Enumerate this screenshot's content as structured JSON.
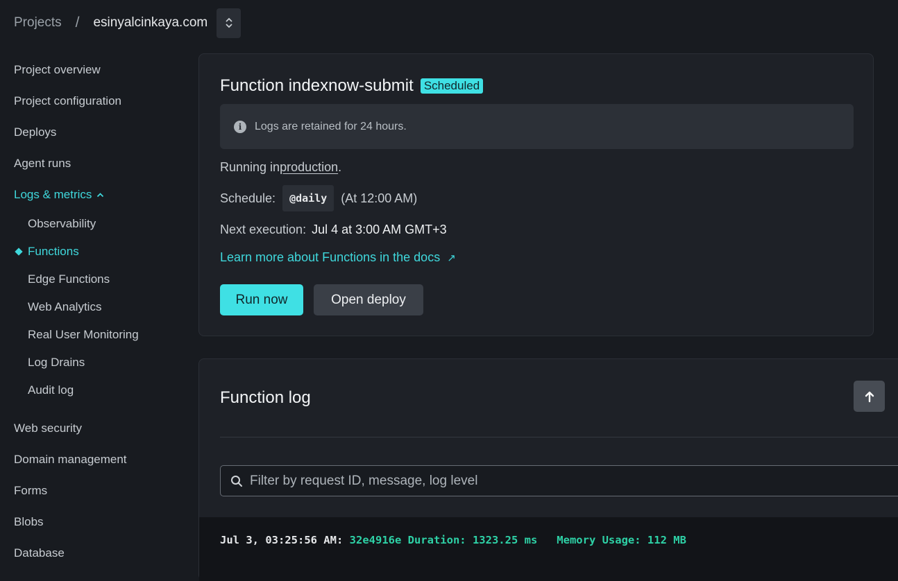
{
  "breadcrumb": {
    "projects": "Projects",
    "separator": "/",
    "site": "esinyalcinkaya.com"
  },
  "sidebar": {
    "items": [
      {
        "label": "Project overview"
      },
      {
        "label": "Project configuration"
      },
      {
        "label": "Deploys"
      },
      {
        "label": "Agent runs"
      },
      {
        "label": "Logs & metrics",
        "expanded": true
      }
    ],
    "subitems": [
      {
        "label": "Observability"
      },
      {
        "label": "Functions",
        "current": true
      },
      {
        "label": "Edge Functions"
      },
      {
        "label": "Web Analytics"
      },
      {
        "label": "Real User Monitoring"
      },
      {
        "label": "Log Drains"
      },
      {
        "label": "Audit log"
      }
    ],
    "items_after": [
      {
        "label": "Web security"
      },
      {
        "label": "Domain management"
      },
      {
        "label": "Forms"
      },
      {
        "label": "Blobs"
      },
      {
        "label": "Database"
      }
    ]
  },
  "function_card": {
    "title": "Function indexnow-submit",
    "badge": "Scheduled",
    "notice": "Logs are retained for 24 hours.",
    "running_prefix": "Running in ",
    "running_env": "production",
    "running_suffix": ".",
    "schedule_label": "Schedule:",
    "schedule_cron": "@daily",
    "schedule_human": "(At 12:00 AM)",
    "next_label": "Next execution:",
    "next_value": "Jul 4 at 3:00 AM GMT+3",
    "docs_link": "Learn more about Functions in the docs",
    "run_now": "Run now",
    "open_deploy": "Open deploy"
  },
  "function_log": {
    "title": "Function log",
    "filter_placeholder": "Filter by request ID, message, log level",
    "entries": [
      {
        "timestamp": "Jul 3, 03:25:56 AM:",
        "message": "32e4916e Duration: 1323.25 ms",
        "memory": "Memory Usage: 112 MB"
      }
    ]
  },
  "colors": {
    "accent": "#3fd8dc",
    "button_primary": "#3fe0e4",
    "log_text": "#2ed1a6",
    "background": "#181b20",
    "card": "#1e2127"
  },
  "icons": [
    "chevron-updown-icon",
    "chevron-up-icon",
    "info-icon",
    "external-link-icon",
    "arrow-up-icon",
    "search-icon"
  ]
}
